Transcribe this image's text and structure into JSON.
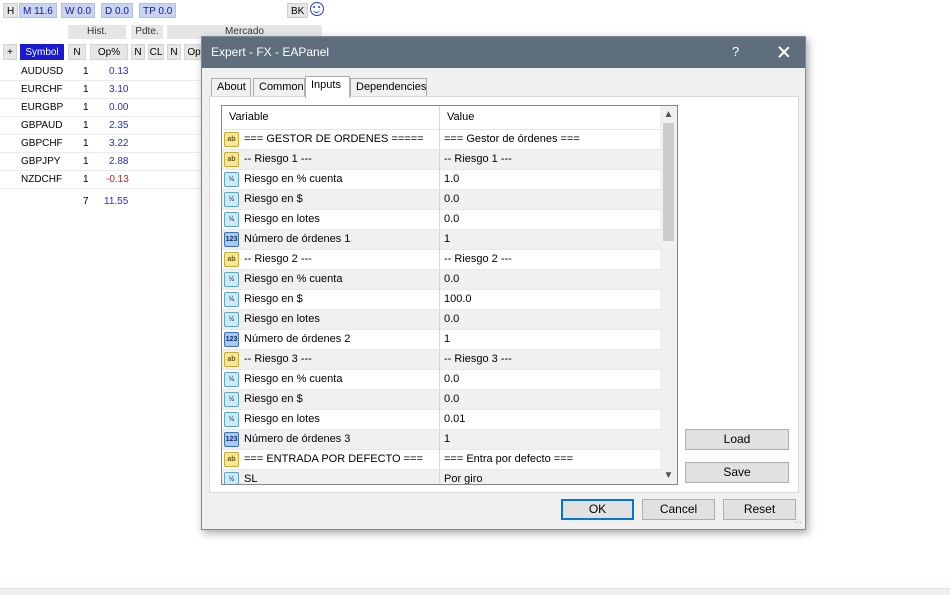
{
  "top_bar": {
    "items": [
      {
        "label": "H"
      },
      {
        "label": "M 11.6"
      },
      {
        "label": "W 0.0"
      },
      {
        "label": "D 0.0"
      },
      {
        "label": "TP 0.0"
      }
    ],
    "bk_label": "BK"
  },
  "panel": {
    "header_hist": "Hist.",
    "header_pdte": "Pdte.",
    "header_mercado": "Mercado",
    "columns": [
      "+",
      "Symbol",
      "N",
      "Op%",
      "N",
      "CL",
      "N",
      "Op"
    ],
    "rows": [
      {
        "symbol": "AUDUSD",
        "n": "1",
        "op": "0.13"
      },
      {
        "symbol": "EURCHF",
        "n": "1",
        "op": "3.10"
      },
      {
        "symbol": "EURGBP",
        "n": "1",
        "op": "0.00"
      },
      {
        "symbol": "GBPAUD",
        "n": "1",
        "op": "2.35"
      },
      {
        "symbol": "GBPCHF",
        "n": "1",
        "op": "3.22"
      },
      {
        "symbol": "GBPJPY",
        "n": "1",
        "op": "2.88"
      },
      {
        "symbol": "NZDCHF",
        "n": "1",
        "op": "-0.13"
      }
    ],
    "total_n": "7",
    "total_op": "11.55",
    "colors": {
      "positive": "#1f2fc9",
      "negative": "#d21e1e",
      "symbol_header": "#1a1ad1"
    }
  },
  "dialog": {
    "title": "Expert - FX - EAPanel",
    "help_label": "?",
    "tabs": [
      "About",
      "Common",
      "Inputs",
      "Dependencies"
    ],
    "active_tab": "Inputs",
    "grid_headers": {
      "variable": "Variable",
      "value": "Value"
    },
    "rows": [
      {
        "icon": "ab",
        "variable": "=== GESTOR DE ORDENES =====",
        "value": "=== Gestor de órdenes ==="
      },
      {
        "icon": "ab",
        "variable": "-- Riesgo 1 ---",
        "value": "-- Riesgo 1 ---"
      },
      {
        "icon": "half",
        "variable": "Riesgo en % cuenta",
        "value": "1.0"
      },
      {
        "icon": "half",
        "variable": "Riesgo en $",
        "value": "0.0"
      },
      {
        "icon": "half",
        "variable": "Riesgo en lotes",
        "value": "0.0"
      },
      {
        "icon": "num",
        "variable": "Número de órdenes 1",
        "value": "1"
      },
      {
        "icon": "ab",
        "variable": "-- Riesgo 2 ---",
        "value": "-- Riesgo 2 ---"
      },
      {
        "icon": "half",
        "variable": "Riesgo en % cuenta",
        "value": "0.0"
      },
      {
        "icon": "half",
        "variable": "Riesgo en $",
        "value": "100.0"
      },
      {
        "icon": "half",
        "variable": "Riesgo en lotes",
        "value": "0.0"
      },
      {
        "icon": "num",
        "variable": "Número de órdenes 2",
        "value": "1"
      },
      {
        "icon": "ab",
        "variable": "-- Riesgo 3 ---",
        "value": "-- Riesgo 3 ---"
      },
      {
        "icon": "half",
        "variable": "Riesgo en % cuenta",
        "value": "0.0"
      },
      {
        "icon": "half",
        "variable": "Riesgo en $",
        "value": "0.0"
      },
      {
        "icon": "half",
        "variable": "Riesgo en lotes",
        "value": "0.01"
      },
      {
        "icon": "num",
        "variable": "Número de órdenes 3",
        "value": "1"
      },
      {
        "icon": "ab",
        "variable": "=== ENTRADA POR DEFECTO ===",
        "value": "=== Entra por defecto ==="
      },
      {
        "icon": "half",
        "variable": "SL",
        "value": "Por giro"
      }
    ],
    "icon_glyphs": {
      "ab": "ab",
      "half": "½",
      "num": "123"
    },
    "buttons": {
      "load": "Load",
      "save": "Save",
      "ok": "OK",
      "cancel": "Cancel",
      "reset": "Reset"
    }
  }
}
